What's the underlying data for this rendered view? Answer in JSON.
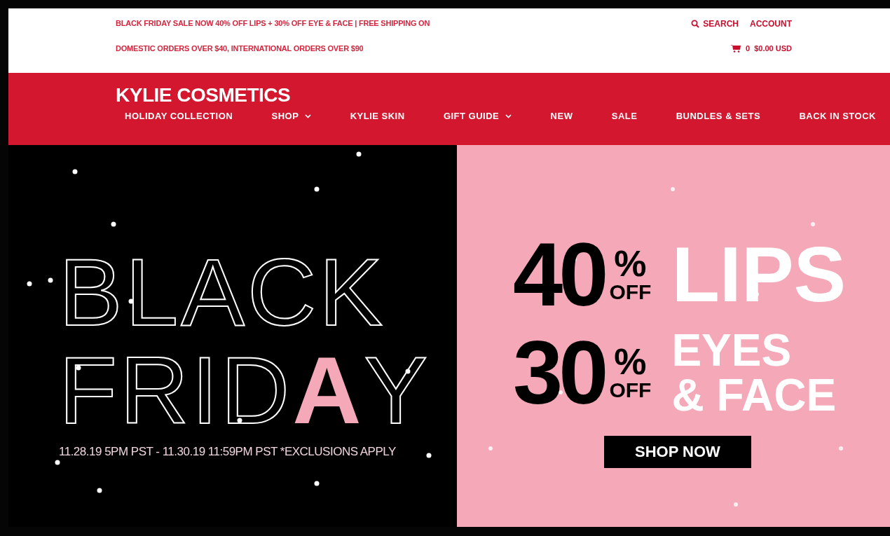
{
  "promo": {
    "lines": [
      "BLACK FRIDAY SALE NOW 40% OFF LIPS + 30% OFF EYE & FACE | FREE SHIPPING ON",
      "DOMESTIC ORDERS OVER $40, INTERNATIONAL ORDERS OVER $90"
    ]
  },
  "utility": {
    "search": "SEARCH",
    "account": "ACCOUNT",
    "cart_count": "0",
    "cart_total": "$0.00 USD"
  },
  "brand": "KYLIE COSMETICS",
  "nav": [
    {
      "label": "HOLIDAY COLLECTION",
      "has_menu": false
    },
    {
      "label": "SHOP",
      "has_menu": true
    },
    {
      "label": "KYLIE SKIN",
      "has_menu": false
    },
    {
      "label": "GIFT GUIDE",
      "has_menu": true
    },
    {
      "label": "NEW",
      "has_menu": false
    },
    {
      "label": "SALE",
      "has_menu": false
    },
    {
      "label": "BUNDLES & SETS",
      "has_menu": false
    },
    {
      "label": "BACK IN STOCK",
      "has_menu": false
    }
  ],
  "hero": {
    "headline": [
      [
        {
          "text": "BLACK",
          "highlight": false
        }
      ],
      [
        {
          "text": "FRID",
          "highlight": false
        },
        {
          "text": "A",
          "highlight": true
        },
        {
          "text": "Y",
          "highlight": false
        }
      ]
    ],
    "dates": "11.28.19 5PM PST - 11.30.19 11:59PM PST *EXCLUSIONS APPLY",
    "offers": [
      {
        "amount": "40",
        "percent": "%",
        "off": "OFF",
        "lines": [
          "LIPS"
        ]
      },
      {
        "amount": "30",
        "percent": "%",
        "off": "OFF",
        "lines": [
          "EYES",
          "& FACE"
        ]
      }
    ],
    "cta": "SHOP NOW"
  }
}
